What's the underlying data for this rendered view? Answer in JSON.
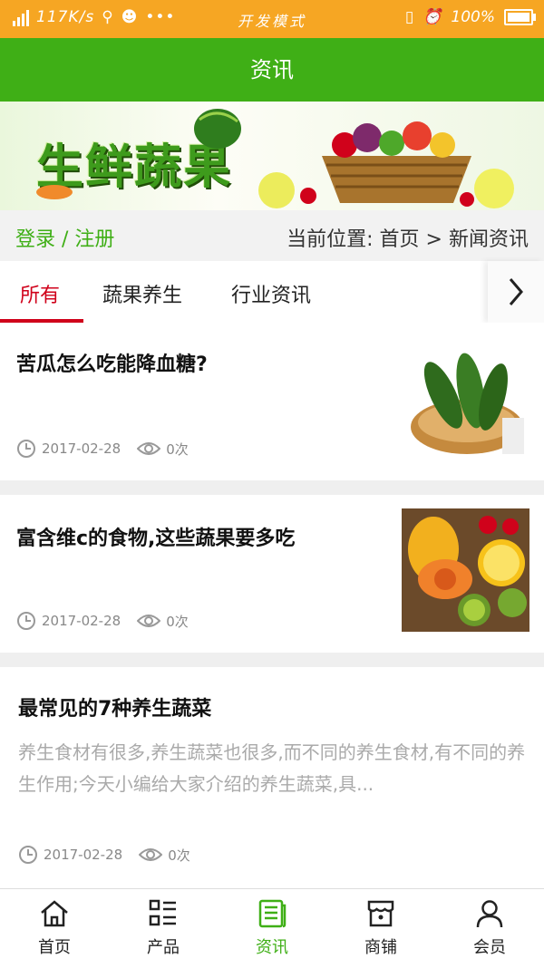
{
  "status_bar": {
    "network": "4G",
    "speed": "117K/s",
    "mode": "开发模式",
    "battery": "100%"
  },
  "header": {
    "title": "资讯"
  },
  "banner": {
    "brand_text": "生鲜蔬果"
  },
  "crumb": {
    "login_label": "登录 / 注册",
    "location_label": "当前位置:",
    "home": "首页",
    "separator": ">",
    "current": "新闻资讯"
  },
  "tabs": [
    {
      "label": "所有",
      "active": true
    },
    {
      "label": "蔬果养生",
      "active": false
    },
    {
      "label": "行业资讯",
      "active": false
    }
  ],
  "articles": [
    {
      "title": "苦瓜怎么吃能降血糖?",
      "date": "2017-02-28",
      "views": "0次",
      "summary": "",
      "image": "bitter-melon-basket"
    },
    {
      "title": "富含维c的食物,这些蔬果要多吃",
      "date": "2017-02-28",
      "views": "0次",
      "summary": "",
      "image": "fruit-platter"
    },
    {
      "title": "最常见的7种养生蔬菜",
      "date": "2017-02-28",
      "views": "0次",
      "summary": "养生食材有很多,养生蔬菜也很多,而不同的养生食材,有不同的养生作用;今天小编给大家介绍的养生蔬菜,具..."
    }
  ],
  "bottom_nav": [
    {
      "label": "首页",
      "icon": "home-icon",
      "active": false
    },
    {
      "label": "产品",
      "icon": "list-icon",
      "active": false
    },
    {
      "label": "资讯",
      "icon": "news-icon",
      "active": true
    },
    {
      "label": "商铺",
      "icon": "store-icon",
      "active": false
    },
    {
      "label": "会员",
      "icon": "user-icon",
      "active": false
    }
  ],
  "colors": {
    "status_bar": "#f6a623",
    "header": "#3faf16",
    "accent_green": "#3faf16",
    "tab_active": "#d0021b"
  }
}
